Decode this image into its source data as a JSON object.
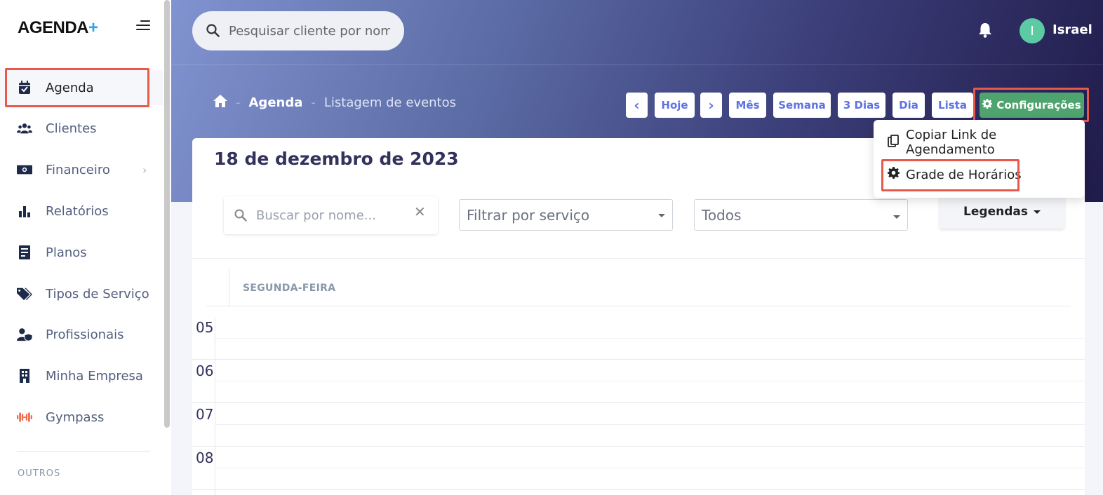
{
  "sidebar": {
    "logo_main": "AGENDA",
    "logo_plus": "+",
    "items": [
      {
        "label": "Agenda",
        "icon": "calendar-check-icon"
      },
      {
        "label": "Clientes",
        "icon": "users-icon"
      },
      {
        "label": "Financeiro",
        "icon": "money-bill-icon"
      },
      {
        "label": "Relatórios",
        "icon": "bar-chart-icon"
      },
      {
        "label": "Planos",
        "icon": "document-icon"
      },
      {
        "label": "Tipos de Serviço",
        "icon": "tags-icon"
      },
      {
        "label": "Profissionais",
        "icon": "user-shield-icon"
      },
      {
        "label": "Minha Empresa",
        "icon": "building-icon"
      },
      {
        "label": "Gympass",
        "icon": "dumbbell-icon"
      }
    ],
    "section_others": "OUTROS"
  },
  "header": {
    "search_placeholder": "Pesquisar cliente por nome",
    "user_initial": "I",
    "user_name": "Israel"
  },
  "breadcrumb": {
    "home_icon": "home-icon",
    "section": "Agenda",
    "page": "Listagem de eventos",
    "separator": "-"
  },
  "toolbar": {
    "prev": "‹",
    "today": "Hoje",
    "next": "›",
    "month": "Mês",
    "week": "Semana",
    "three_days": "3 Dias",
    "day": "Dia",
    "list": "Lista",
    "config": "Configurações"
  },
  "config_menu": {
    "items": [
      {
        "label": "Copiar Link de Agendamento",
        "icon": "copy-icon"
      },
      {
        "label": "Grade de Horários",
        "icon": "gear-icon"
      }
    ]
  },
  "main": {
    "date_title": "18 de dezembro de 2023",
    "search_placeholder": "Buscar por nome...",
    "clear": "✕",
    "service_filter": "Filtrar por serviço",
    "status_filter": "Todos",
    "legend_button": "Legendas"
  },
  "calendar": {
    "day_header": "SEGUNDA-FEIRA",
    "hours": [
      "05",
      "06",
      "07",
      "08"
    ]
  },
  "colors": {
    "accent": "#5e72e4",
    "config_green": "#4fa36e",
    "highlight": "#e8594a",
    "avatar": "#5ccba4"
  }
}
